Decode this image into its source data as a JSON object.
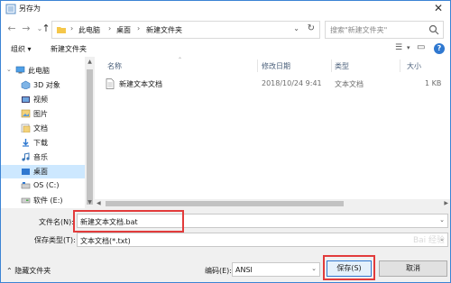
{
  "window": {
    "title": "另存为"
  },
  "address": {
    "crumbs": [
      "此电脑",
      "桌面",
      "新建文件夹"
    ],
    "search_placeholder": "搜索\"新建文件夹\""
  },
  "toolbar": {
    "organize": "组织 ▾",
    "new_folder": "新建文件夹"
  },
  "nav": {
    "items": [
      {
        "label": "此电脑",
        "icon": "computer-icon"
      },
      {
        "label": "3D 对象",
        "icon": "cube-folder-icon"
      },
      {
        "label": "视频",
        "icon": "video-folder-icon"
      },
      {
        "label": "图片",
        "icon": "pictures-folder-icon"
      },
      {
        "label": "文档",
        "icon": "documents-folder-icon"
      },
      {
        "label": "下载",
        "icon": "downloads-folder-icon"
      },
      {
        "label": "音乐",
        "icon": "music-folder-icon"
      },
      {
        "label": "桌面",
        "icon": "desktop-folder-icon"
      },
      {
        "label": "OS (C:)",
        "icon": "drive-icon"
      },
      {
        "label": "软件 (E:)",
        "icon": "drive-icon"
      }
    ]
  },
  "files": {
    "columns": [
      "名称",
      "修改日期",
      "类型",
      "大小"
    ],
    "rows": [
      {
        "name": "新建文本文档",
        "modified": "2018/10/24 9:41",
        "type": "文本文档",
        "size": "1 KB"
      }
    ]
  },
  "save": {
    "filename_label": "文件名(N):",
    "filename_value": "新建文本文档.bat",
    "type_label": "保存类型(T):",
    "type_value": "文本文档(*.txt)",
    "hide_folders": "隐藏文件夹",
    "encoding_label": "编码(E):",
    "encoding_value": "ANSI",
    "save_button": "保存(S)",
    "cancel_button": "取消"
  },
  "watermark": "Bai 经验",
  "colors": {
    "accent": "#2f78d0",
    "highlight": "#e23b3b",
    "selected": "#cde8ff"
  }
}
